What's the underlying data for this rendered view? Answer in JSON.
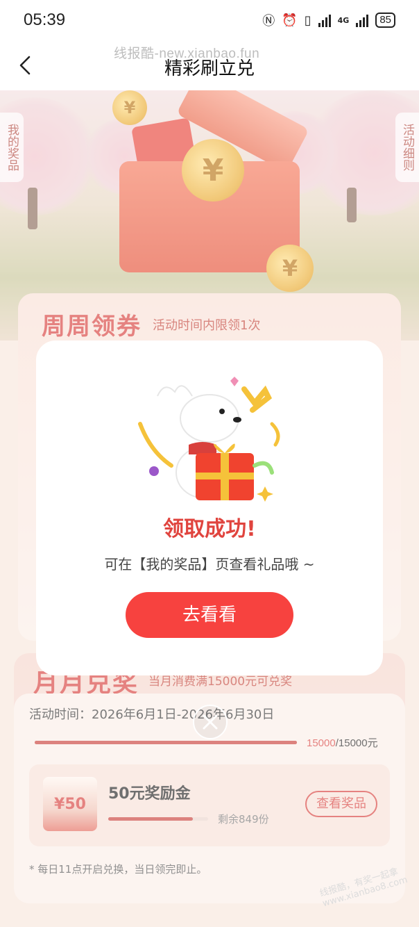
{
  "status_bar": {
    "time": "05:39",
    "network": "4G",
    "battery": "85"
  },
  "nav": {
    "title": "精彩刷立兑",
    "watermark": "线报酷-new.xianbao.fun"
  },
  "side_tabs": {
    "left": "我的奖品",
    "right": "活动细则"
  },
  "hero": {
    "coin_symbol": "¥"
  },
  "section_weekly": {
    "title": "周周领券",
    "subtitle": "活动时间内限领1次"
  },
  "section_monthly": {
    "title": "月月兑奖",
    "subtitle": "当月消费满15000元可兑奖",
    "activity_time": "活动时间：2026年6月1日-2026年6月30日",
    "progress": {
      "current": "15000",
      "total": "/15000元",
      "fraction": 1.0
    },
    "prize": {
      "badge": "¥50",
      "name": "50元奖励金",
      "remaining": "剩余849份",
      "remaining_fraction": 0.85,
      "button": "查看奖品"
    },
    "note": "* 每日11点开启兑换，当日领完即止。"
  },
  "bottom_watermark": "线报酷，有奖一起拿 www.xianbao8.com",
  "modal": {
    "title": "领取成功!",
    "description": "可在【我的奖品】页查看礼品哦 ~",
    "button": "去看看"
  },
  "colors": {
    "accent": "#f7423f",
    "title_red": "#e0443e",
    "card_bg": "#fbeee8"
  }
}
